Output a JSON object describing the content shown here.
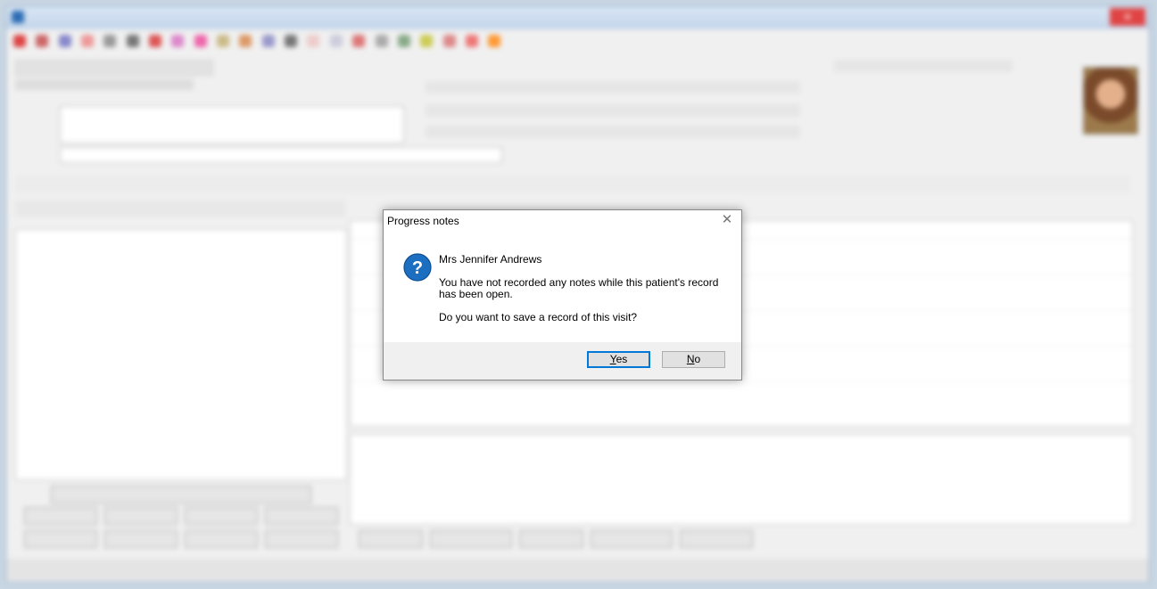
{
  "app": {
    "colors": {
      "accent": "#0078d7",
      "frame": "#8aa2bf",
      "dialog_bg": "#ffffff",
      "footer_bg": "#f0f0f0"
    }
  },
  "dialog": {
    "title": "Progress notes",
    "close_icon": "close-icon",
    "icon": "question-icon",
    "patient_name": "Mrs Jennifer Andrews",
    "message_line1": "You have not recorded any notes while this patient's record",
    "message_line2": "has been open.",
    "question": "Do you want to save a record of this visit?",
    "yes_prefix": "",
    "yes_mnemonic": "Y",
    "yes_rest": "es",
    "no_prefix": "",
    "no_mnemonic": "N",
    "no_rest": "o"
  }
}
